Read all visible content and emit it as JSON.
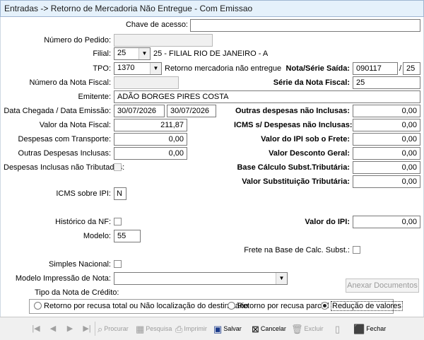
{
  "window": {
    "title": "Entradas -> Retorno de Mercadoria Não Entregue - Com Emissao"
  },
  "form": {
    "chave_acesso": {
      "label": "Chave de acesso:",
      "value": ""
    },
    "numero_pedido": {
      "label": "Número do Pedido:",
      "value": ""
    },
    "filial": {
      "label": "Filial:",
      "value": "25",
      "description": "25 - FILIAL RIO DE JANEIRO - A"
    },
    "tpo": {
      "label": "TPO:",
      "value": "1370",
      "description": "Retorno mercadoria não entregue"
    },
    "nota_serie_saida": {
      "label": "Nota/Série Saída:",
      "nota": "090117",
      "sep": "/",
      "serie": "25"
    },
    "numero_nota_fiscal": {
      "label": "Número da Nota Fiscal:",
      "value": ""
    },
    "serie_nota_fiscal": {
      "label": "Série da Nota Fiscal:",
      "value": "25"
    },
    "emitente": {
      "label": "Emitente:",
      "value": "ADÃO BORGES PIRES COSTA"
    },
    "datas": {
      "label": "Data Chegada / Data Emissão:",
      "chegada": "30/07/2026",
      "emissao": "30/07/2026"
    },
    "outras_despesas_nao_inclusas": {
      "label": "Outras despesas não Inclusas:",
      "value": "0,00"
    },
    "valor_nota_fiscal": {
      "label": "Valor da Nota Fiscal:",
      "value": "211,87"
    },
    "icms_despesas_nao_inclusas": {
      "label": "ICMS s/ Despesas não Inclusas:",
      "value": "0,00"
    },
    "despesas_transporte": {
      "label": "Despesas com Transporte:",
      "value": "0,00"
    },
    "valor_ipi_frete": {
      "label": "Valor do IPI sob o Frete:",
      "value": "0,00"
    },
    "outras_despesas_inclusas": {
      "label": "Outras Despesas Inclusas:",
      "value": "0,00"
    },
    "valor_desconto_geral": {
      "label": "Valor Desconto Geral:",
      "value": "0,00"
    },
    "despesas_inclusas_nao_tributadas": {
      "label": "Despesas Inclusas não Tributadas:",
      "checked": false
    },
    "base_calculo_st": {
      "label": "Base Cálculo Subst.Tributária:",
      "value": "0,00"
    },
    "valor_substituicao_tributaria": {
      "label": "Valor Substituição Tributária:",
      "value": "0,00"
    },
    "icms_sobre_ipi": {
      "label": "ICMS sobre IPI:",
      "value": "N"
    },
    "historico_nf": {
      "label": "Histórico da NF:",
      "checked": false
    },
    "valor_ipi": {
      "label": "Valor do IPI:",
      "value": "0,00"
    },
    "modelo": {
      "label": "Modelo:",
      "value": "55"
    },
    "frete_base_calc": {
      "label": "Frete na Base de Calc. Subst.:",
      "checked": false
    },
    "simples_nacional": {
      "label": "Simples Nacional:",
      "checked": false
    },
    "modelo_impressao": {
      "label": "Modelo Impressão de Nota:",
      "value": ""
    },
    "anexar_documentos": "Anexar Documentos",
    "tipo_nota_credito": {
      "label": "Tipo da Nota de Crédito:",
      "options": [
        "Retorno por recusa total ou Não localização do destinatário",
        "Retorno por recusa parcial",
        "Redução de valores"
      ],
      "selected": 2
    }
  },
  "toolbar": {
    "procurar": "Procurar",
    "pesquisa": "Pesquisa",
    "imprimir": "Imprimir",
    "salvar": "Salvar",
    "cancelar": "Cancelar",
    "excluir": "Excluir",
    "fechar": "Fechar"
  },
  "icons": {
    "first": "first-record-icon",
    "prev": "prev-record-icon",
    "next": "next-record-icon",
    "last": "last-record-icon",
    "procurar": "binoculars-icon",
    "pesquisa": "grid-icon",
    "imprimir": "printer-icon",
    "salvar": "floppy-disk-icon",
    "cancelar": "cancel-icon",
    "excluir": "trash-icon",
    "fechar": "exit-door-icon"
  }
}
